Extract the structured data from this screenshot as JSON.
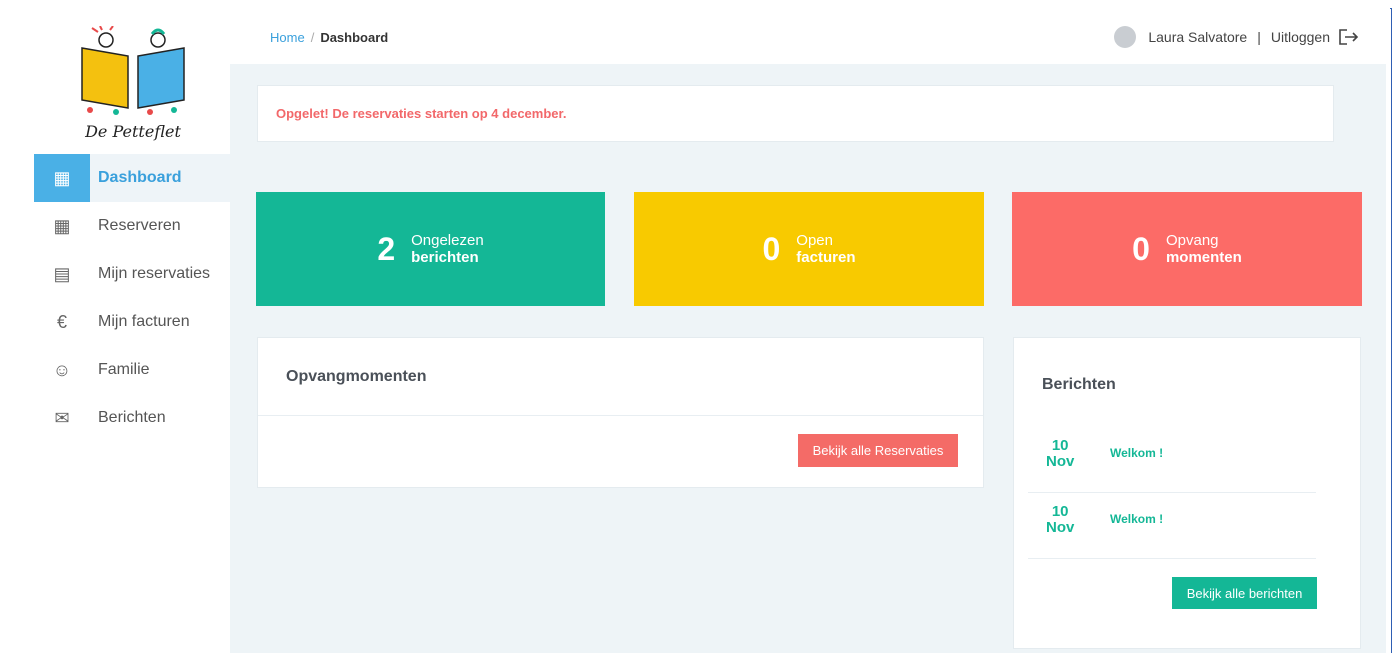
{
  "logo": {
    "name": "De Petteflet"
  },
  "breadcrumb": {
    "home": "Home",
    "separator": "/",
    "current": "Dashboard"
  },
  "user": {
    "name": "Laura Salvatore",
    "divider": "|",
    "logout": "Uitloggen"
  },
  "sidebar": {
    "items": [
      {
        "label": "Dashboard",
        "icon": "dashboard-icon",
        "glyph": "▦",
        "active": true
      },
      {
        "label": "Reserveren",
        "icon": "calendar-icon",
        "glyph": "▦",
        "active": false
      },
      {
        "label": "Mijn reservaties",
        "icon": "document-icon",
        "glyph": "▤",
        "active": false
      },
      {
        "label": "Mijn facturen",
        "icon": "euro-icon",
        "glyph": "€",
        "active": false
      },
      {
        "label": "Familie",
        "icon": "family-icon",
        "glyph": "☺",
        "active": false
      },
      {
        "label": "Berichten",
        "icon": "envelope-icon",
        "glyph": "✉",
        "active": false
      }
    ]
  },
  "alert": {
    "text": "Opgelet! De reservaties starten op 4 december."
  },
  "stats": [
    {
      "value": "2",
      "line1": "Ongelezen",
      "line2": "berichten",
      "color": "#14b796"
    },
    {
      "value": "0",
      "line1": "Open",
      "line2": "facturen",
      "color": "#f8ca00"
    },
    {
      "value": "0",
      "line1": "Opvang",
      "line2": "momenten",
      "color": "#fc6b67"
    }
  ],
  "opvang": {
    "title": "Opvangmomenten",
    "button": "Bekijk alle Reservaties"
  },
  "berichten": {
    "title": "Berichten",
    "items": [
      {
        "day": "10",
        "month": "Nov",
        "title": "Welkom !"
      },
      {
        "day": "10",
        "month": "Nov",
        "title": "Welkom !"
      }
    ],
    "button": "Bekijk alle berichten"
  },
  "colors": {
    "accent": "#3aa0dc",
    "green": "#14b796",
    "yellow": "#f8ca00",
    "red": "#fc6b67"
  }
}
